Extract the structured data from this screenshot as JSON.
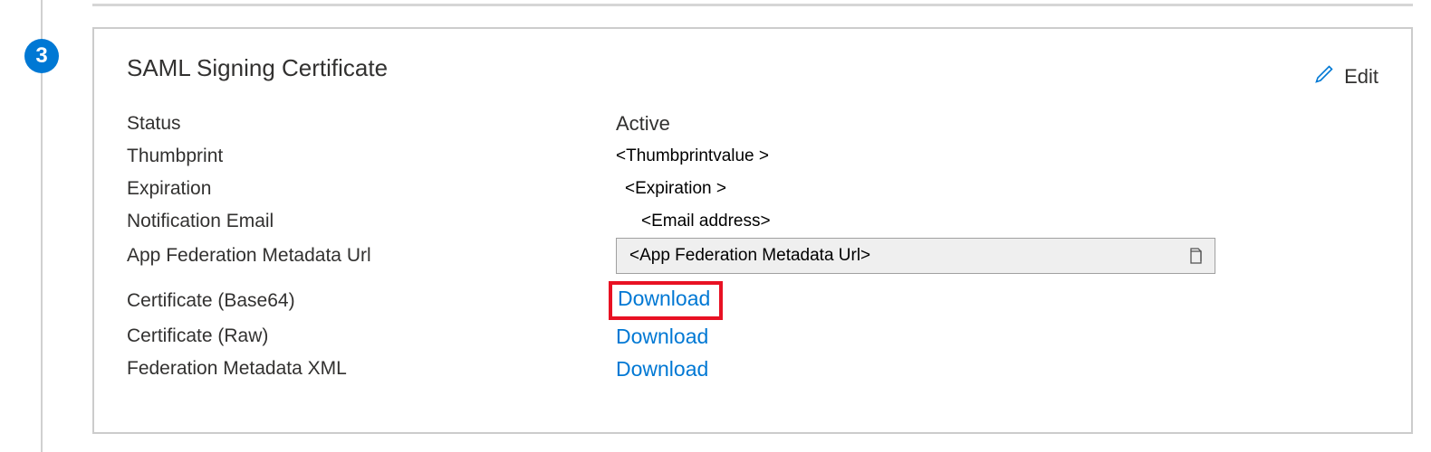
{
  "step": {
    "number": "3"
  },
  "card": {
    "title": "SAML Signing Certificate",
    "edit_label": "Edit"
  },
  "fields": {
    "status": {
      "label": "Status",
      "value": "Active"
    },
    "thumbprint": {
      "label": "Thumbprint",
      "value": "<Thumbprintvalue >"
    },
    "expiration": {
      "label": "Expiration",
      "value": "<Expiration >"
    },
    "notification_email": {
      "label": "Notification Email",
      "value": "<Email address>"
    },
    "app_federation_metadata_url": {
      "label": "App Federation Metadata Url",
      "value": "<App Federation  Metadata Url>"
    },
    "certificate_base64": {
      "label": "Certificate (Base64)",
      "action": "Download"
    },
    "certificate_raw": {
      "label": "Certificate (Raw)",
      "action": "Download"
    },
    "federation_metadata_xml": {
      "label": "Federation Metadata XML",
      "action": "Download"
    }
  }
}
